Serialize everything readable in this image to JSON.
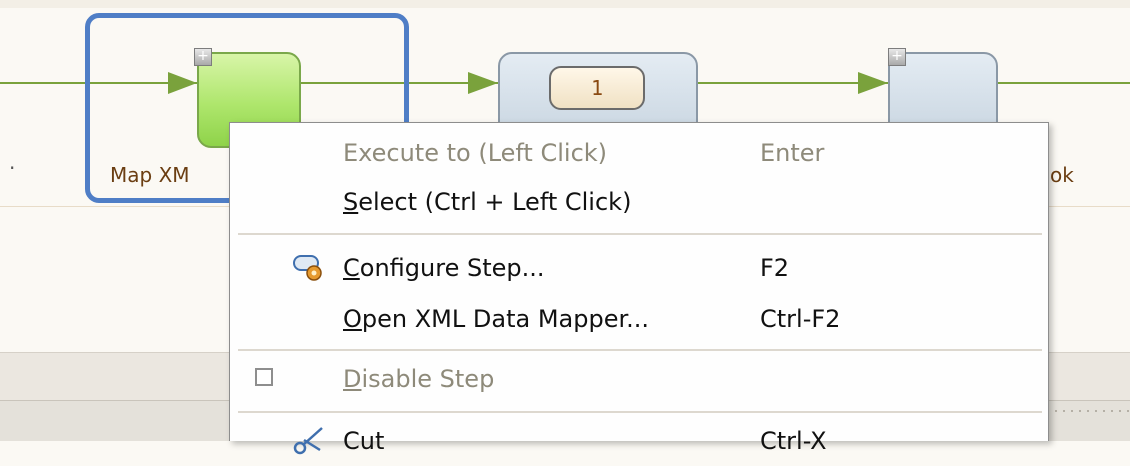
{
  "canvas": {
    "steps": [
      {
        "label": "Map XM",
        "selected": true,
        "color": "#a9e36a"
      },
      {
        "counter": "1",
        "color": "#c9d6e2"
      },
      {
        "label": "ok",
        "color": "#c9d6e2"
      }
    ],
    "expand_glyph": "+",
    "flow_color": "#7aa23c",
    "selection_color": "#4f7ec6"
  },
  "context_menu": {
    "items": [
      {
        "label": "Execute to (Left Click)",
        "shortcut": "Enter",
        "enabled": false
      },
      {
        "label_mnemonic": "S",
        "label_rest": "elect (Ctrl + Left Click)",
        "shortcut": "",
        "enabled": true
      },
      {
        "label_mnemonic": "C",
        "label_rest": "onfigure Step...",
        "shortcut": "F2",
        "enabled": true,
        "icon": "configure-gear-icon"
      },
      {
        "label_mnemonic": "O",
        "label_rest": "pen XML Data Mapper...",
        "shortcut": "Ctrl-F2",
        "enabled": true
      },
      {
        "label_mnemonic": "D",
        "label_rest": "isable Step",
        "shortcut": "",
        "enabled": false,
        "checkbox": false
      },
      {
        "label": "Cut",
        "shortcut": "Ctrl-X",
        "enabled": true,
        "icon": "scissors-icon"
      }
    ]
  }
}
